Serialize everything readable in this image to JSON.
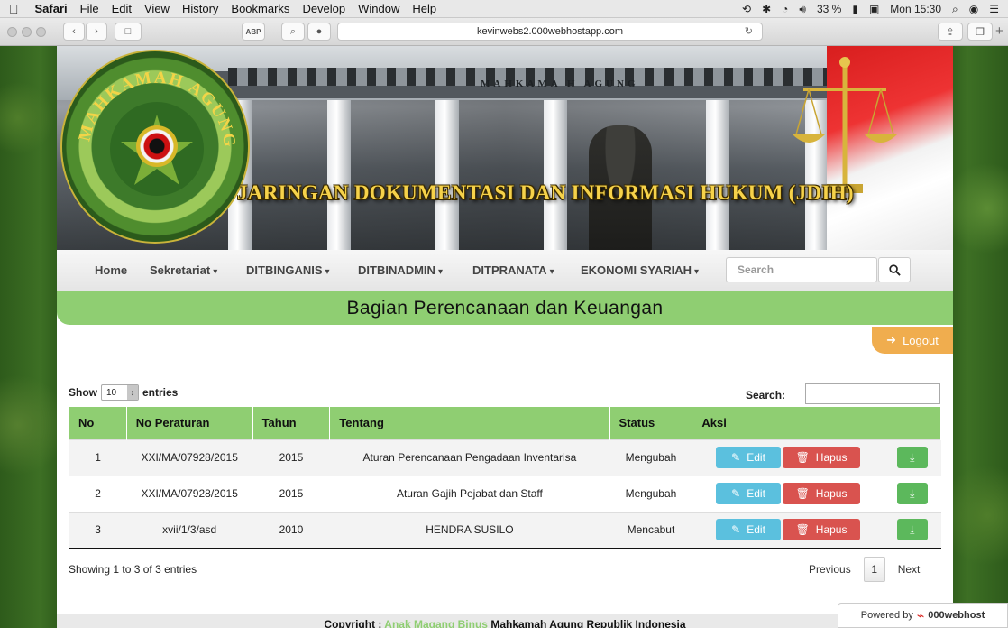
{
  "menubar": {
    "items": [
      "Safari",
      "File",
      "Edit",
      "View",
      "History",
      "Bookmarks",
      "Develop",
      "Window",
      "Help"
    ],
    "battery": "33 %",
    "clock": "Mon 15:30"
  },
  "browser": {
    "url": "kevinwebs2.000webhostapp.com"
  },
  "banner": {
    "building_text": "MAHKAMA  H  AGUNG",
    "logo_text": "MAHKAMAH AGUNG",
    "title": "JARINGAN DOKUMENTASI DAN INFORMASI HUKUM (JDIH)"
  },
  "nav": {
    "items": [
      {
        "label": "Home",
        "dropdown": false
      },
      {
        "label": "Sekretariat",
        "dropdown": true
      },
      {
        "label": "DITBINGANIS",
        "dropdown": true
      },
      {
        "label": "DITBINADMIN",
        "dropdown": true
      },
      {
        "label": "DITPRANATA",
        "dropdown": true
      },
      {
        "label": "EKONOMI SYARIAH",
        "dropdown": true
      }
    ],
    "search_placeholder": "Search"
  },
  "page": {
    "heading": "Bagian Perencanaan dan Keuangan",
    "logout": "Logout"
  },
  "table_controls": {
    "show_label": "Show",
    "entries_label": "entries",
    "page_length": "10",
    "search_label": "Search:"
  },
  "table": {
    "headers": [
      "No",
      "No Peraturan",
      "Tahun",
      "Tentang",
      "Status",
      "Aksi",
      ""
    ],
    "rows": [
      {
        "no": "1",
        "no_peraturan": "XXI/MA/07928/2015",
        "tahun": "2015",
        "tentang": "Aturan Perencanaan Pengadaan Inventarisa",
        "status": "Mengubah"
      },
      {
        "no": "2",
        "no_peraturan": "XXI/MA/07928/2015",
        "tahun": "2015",
        "tentang": "Aturan Gajih Pejabat dan Staff",
        "status": "Mengubah"
      },
      {
        "no": "3",
        "no_peraturan": "xvii/1/3/asd",
        "tahun": "2010",
        "tentang": "HENDRA SUSILO",
        "status": "Mencabut"
      }
    ],
    "edit_label": "Edit",
    "delete_label": "Hapus"
  },
  "pagination": {
    "info": "Showing 1 to 3 of 3 entries",
    "previous": "Previous",
    "current": "1",
    "next": "Next"
  },
  "footer": {
    "prefix": "Copyright : ",
    "link": "Anak Magang Binus",
    "suffix": " Mahkamah Agung Republik Indonesia"
  },
  "powered": {
    "label": "Powered by",
    "brand": "000webhost"
  },
  "colors": {
    "accent_green": "#8fce72",
    "edit_blue": "#5bc0de",
    "delete_red": "#d9534f",
    "download_green": "#5cb85c",
    "logout_orange": "#f0ad4e"
  },
  "icons": [
    "apple-icon",
    "back-icon",
    "forward-icon",
    "sidebar-icon",
    "adblock-icon",
    "search-icon",
    "privacy-icon",
    "reload-icon",
    "share-icon",
    "tabs-icon",
    "new-tab-icon",
    "logout-icon",
    "edit-icon",
    "trash-icon",
    "download-icon"
  ]
}
